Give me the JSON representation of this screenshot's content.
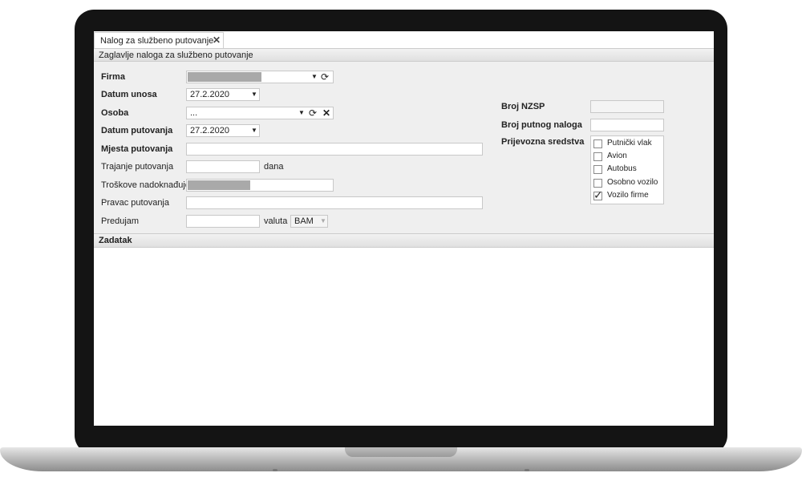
{
  "tab": {
    "label": "Nalog za službeno putovanje",
    "close": "✕"
  },
  "header_section": "Zaglavlje naloga za službeno putovanje",
  "form": {
    "firma": {
      "label": "Firma",
      "value": ""
    },
    "datum_unosa": {
      "label": "Datum unosa",
      "value": "27.2.2020"
    },
    "osoba": {
      "label": "Osoba",
      "value": "..."
    },
    "datum_putovanja": {
      "label": "Datum putovanja",
      "value": "27.2.2020"
    },
    "mjesta_putovanja": {
      "label": "Mjesta putovanja",
      "value": ""
    },
    "trajanje": {
      "label": "Trajanje putovanja",
      "value": "",
      "unit": "dana"
    },
    "troskove": {
      "label": "Troškove nadoknađuje",
      "value": ""
    },
    "pravac": {
      "label": "Pravac putovanja",
      "value": ""
    },
    "predujam": {
      "label": "Predujam",
      "value": "",
      "valuta_label": "valuta",
      "valuta_value": "BAM"
    },
    "broj_nzsp": {
      "label": "Broj NZSP",
      "value": ""
    },
    "broj_putnog_naloga": {
      "label": "Broj putnog naloga",
      "value": ""
    },
    "prijevozna_sredstva": {
      "label": "Prijevozna sredstva",
      "options": [
        {
          "label": "Putnički vlak",
          "checked": false
        },
        {
          "label": "Avion",
          "checked": false
        },
        {
          "label": "Autobus",
          "checked": false
        },
        {
          "label": "Osobno vozilo",
          "checked": false
        },
        {
          "label": "Vozilo firme",
          "checked": true
        }
      ]
    }
  },
  "task_section": "Zadatak",
  "icons": {
    "dropdown": "chevron-down-icon",
    "refresh": "refresh-icon",
    "clear": "close-icon",
    "check": "checkmark-icon"
  }
}
